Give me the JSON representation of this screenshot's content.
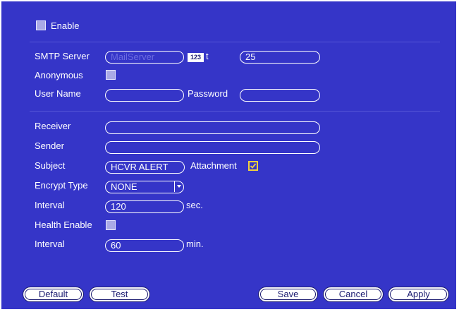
{
  "enable": {
    "label": "Enable",
    "checked": false
  },
  "smtp": {
    "label": "SMTP Server",
    "server_placeholder": "MailServer",
    "ime_badge": "123",
    "port_label_fragment": "t",
    "port_value": "25"
  },
  "anonymous": {
    "label": "Anonymous",
    "checked": false
  },
  "user_name": {
    "label": "User Name",
    "value": ""
  },
  "password": {
    "label": "Password",
    "value": ""
  },
  "receiver": {
    "label": "Receiver",
    "value": ""
  },
  "sender": {
    "label": "Sender",
    "value": ""
  },
  "subject": {
    "label": "Subject",
    "value": "HCVR ALERT"
  },
  "attachment": {
    "label": "Attachment",
    "checked": true
  },
  "encrypt": {
    "label": "Encrypt Type",
    "value": "NONE"
  },
  "interval1": {
    "label": "Interval",
    "value": "120",
    "unit": "sec."
  },
  "health": {
    "label": "Health Enable",
    "checked": false
  },
  "interval2": {
    "label": "Interval",
    "value": "60",
    "unit": "min."
  },
  "buttons": {
    "default": "Default",
    "test": "Test",
    "save": "Save",
    "cancel": "Cancel",
    "apply": "Apply"
  },
  "colors": {
    "panel": "#3535c8",
    "checkbox": "#a9a9e6",
    "check_accent": "#f3d23c"
  }
}
